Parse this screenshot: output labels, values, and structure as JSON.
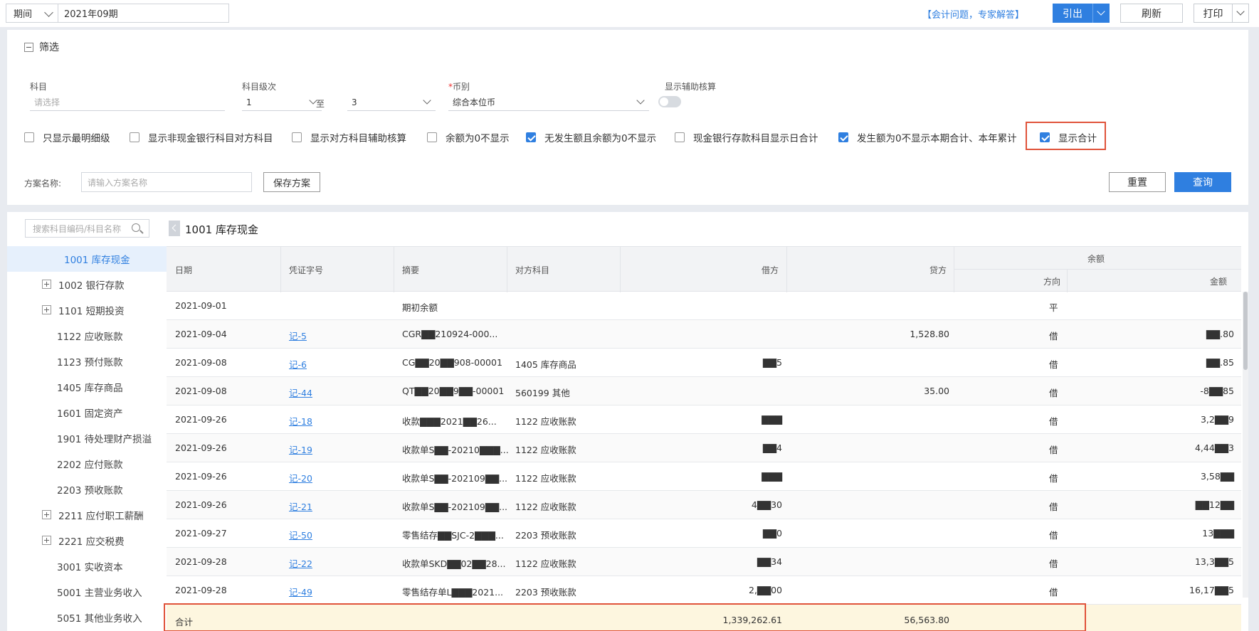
{
  "topbar": {
    "period_label": "期间",
    "period_value": "2021年09期",
    "help_link": "【会计问题，专家解答】",
    "export_label": "引出",
    "refresh_label": "刷新",
    "print_label": "打印"
  },
  "filter": {
    "title": "筛选",
    "subject_label": "科目",
    "subject_placeholder": "请选择",
    "level_label": "科目级次",
    "level_from": "1",
    "level_to_label": "至",
    "level_to": "3",
    "currency_required": "*",
    "currency_label": "币别",
    "currency_value": "综合本位币",
    "aux_label": "显示辅助核算",
    "aux_on": false,
    "checkboxes": [
      {
        "label": "只显示最明细级",
        "checked": false
      },
      {
        "label": "显示非现金银行科目对方科目",
        "checked": false
      },
      {
        "label": "显示对方科目辅助核算",
        "checked": false
      },
      {
        "label": "余额为0不显示",
        "checked": false
      },
      {
        "label": "无发生额且余额为0不显示",
        "checked": true
      },
      {
        "label": "现金银行存款科目显示日合计",
        "checked": false
      },
      {
        "label": "发生额为0不显示本期合计、本年累计",
        "checked": true
      },
      {
        "label": "显示合计",
        "checked": true
      }
    ],
    "plan_label": "方案名称:",
    "plan_placeholder": "请输入方案名称",
    "save_plan_label": "保存方案",
    "reset_label": "重置",
    "query_label": "查询"
  },
  "tree": {
    "search_placeholder": "搜索科目编码/科目名称",
    "items": [
      {
        "label": "1001 库存现金",
        "active": true,
        "expandable": false
      },
      {
        "label": "1002 银行存款",
        "active": false,
        "expandable": true
      },
      {
        "label": "1101 短期投资",
        "active": false,
        "expandable": true
      },
      {
        "label": "1122 应收账款",
        "active": false,
        "expandable": false
      },
      {
        "label": "1123 预付账款",
        "active": false,
        "expandable": false
      },
      {
        "label": "1405 库存商品",
        "active": false,
        "expandable": false
      },
      {
        "label": "1601 固定资产",
        "active": false,
        "expandable": false
      },
      {
        "label": "1901 待处理财产损溢",
        "active": false,
        "expandable": false
      },
      {
        "label": "2202 应付账款",
        "active": false,
        "expandable": false
      },
      {
        "label": "2203 预收账款",
        "active": false,
        "expandable": false
      },
      {
        "label": "2211 应付职工薪酬",
        "active": false,
        "expandable": true
      },
      {
        "label": "2221 应交税费",
        "active": false,
        "expandable": true
      },
      {
        "label": "3001 实收资本",
        "active": false,
        "expandable": false
      },
      {
        "label": "5001 主营业务收入",
        "active": false,
        "expandable": false
      },
      {
        "label": "5051 其他业务收入",
        "active": false,
        "expandable": false
      }
    ]
  },
  "ledger": {
    "title": "1001 库存现金",
    "columns": {
      "date": "日期",
      "voucher": "凭证字号",
      "summary": "摘要",
      "counter": "对方科目",
      "debit": "借方",
      "credit": "贷方",
      "balance": "余额",
      "direction": "方向",
      "amount": "金额"
    },
    "rows": [
      {
        "date": "2021-09-01",
        "voucher": "",
        "summary": "期初余额",
        "counter": "",
        "debit": "",
        "credit": "",
        "direction": "平",
        "amount": ""
      },
      {
        "date": "2021-09-04",
        "voucher": "记-5",
        "summary": "CGR▇▇210924-000...",
        "counter": "",
        "debit": "",
        "credit": "1,528.80",
        "direction": "借",
        "amount": "▇▇.80"
      },
      {
        "date": "2021-09-08",
        "voucher": "记-6",
        "summary": "CG▇▇20▇▇908-00001",
        "counter": "1405 库存商品",
        "debit": "▇▇5",
        "credit": "",
        "direction": "借",
        "amount": "▇▇.85"
      },
      {
        "date": "2021-09-08",
        "voucher": "记-44",
        "summary": "QT▇▇20▇▇9▇▇-00001",
        "counter": "560199 其他",
        "debit": "",
        "credit": "35.00",
        "direction": "借",
        "amount": "-8▇▇85"
      },
      {
        "date": "2021-09-26",
        "voucher": "记-18",
        "summary": "收款▇▇▇2021▇▇26...",
        "counter": "1122 应收账款",
        "debit": "▇▇▇",
        "credit": "",
        "direction": "借",
        "amount": "3,2▇▇9"
      },
      {
        "date": "2021-09-26",
        "voucher": "记-19",
        "summary": "收款单S▇▇-20210▇▇▇...",
        "counter": "1122 应收账款",
        "debit": "▇▇4",
        "credit": "",
        "direction": "借",
        "amount": "4,44▇▇3"
      },
      {
        "date": "2021-09-26",
        "voucher": "记-20",
        "summary": "收款单S▇▇-202109▇▇...",
        "counter": "1122 应收账款",
        "debit": "▇▇▇",
        "credit": "",
        "direction": "借",
        "amount": "3,58▇▇"
      },
      {
        "date": "2021-09-26",
        "voucher": "记-21",
        "summary": "收款单S▇▇-202109▇▇...",
        "counter": "1122 应收账款",
        "debit": "4▇▇30",
        "credit": "",
        "direction": "借",
        "amount": "▇▇12▇▇"
      },
      {
        "date": "2021-09-27",
        "voucher": "记-50",
        "summary": "零售结存▇▇SJC-2▇▇▇...",
        "counter": "2203 预收账款",
        "debit": "▇▇0",
        "credit": "",
        "direction": "借",
        "amount": "13▇▇▇"
      },
      {
        "date": "2021-09-28",
        "voucher": "记-22",
        "summary": "收款单SKD▇▇02▇▇28...",
        "counter": "1122 应收账款",
        "debit": "▇▇34",
        "credit": "",
        "direction": "借",
        "amount": "13,3▇▇5"
      },
      {
        "date": "2021-09-28",
        "voucher": "记-49",
        "summary": "零售结存单L▇▇▇2021...",
        "counter": "2203 预收账款",
        "debit": "2,▇▇00",
        "credit": "",
        "direction": "借",
        "amount": "16,17▇▇5"
      }
    ],
    "total": {
      "label": "合计",
      "debit": "1,339,262.61",
      "credit": "56,563.80"
    }
  }
}
